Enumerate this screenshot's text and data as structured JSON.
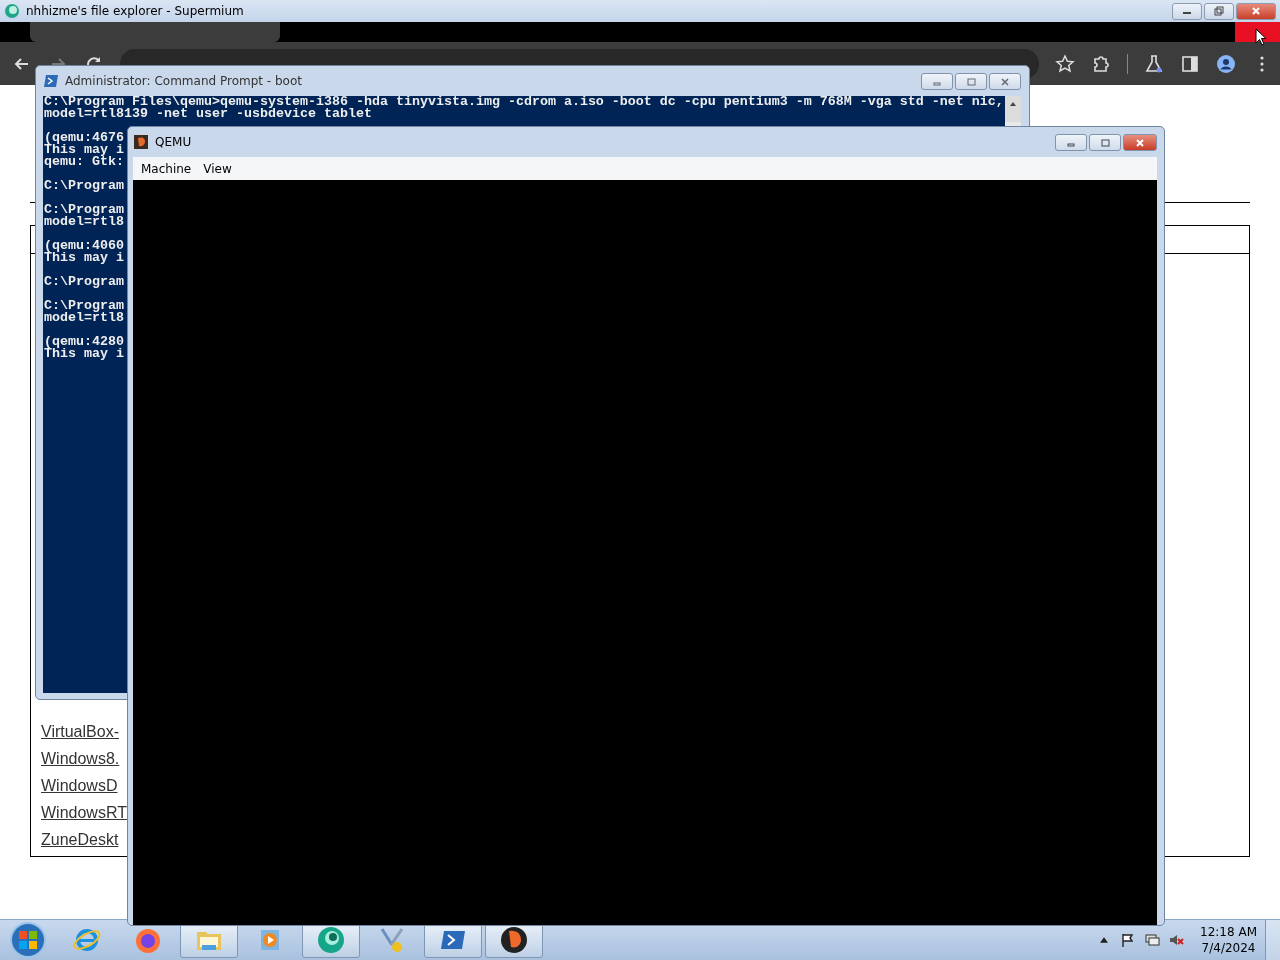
{
  "browser": {
    "title": "nhhizme's file explorer - Supermium",
    "links": [
      "VirtualBox-",
      "Windows8.",
      "WindowsD",
      "WindowsRT",
      "ZuneDeskt"
    ]
  },
  "cmd_window": {
    "title": "Administrator: Command Prompt - boot",
    "blocks": [
      [
        "C:\\Program Files\\qemu>qemu-system-i386 -hda tinyvista.img -cdrom a.iso -boot dc -cpu pentium3 -m 768M -vga std -net nic,",
        "model=rtl8139 -net user -usbdevice tablet"
      ],
      [
        "(qemu:4676",
        "This may i",
        "qemu: Gtk:"
      ],
      [
        "C:\\Program"
      ],
      [
        "C:\\Program",
        "model=rtl8"
      ],
      [
        "(qemu:4060",
        "This may i"
      ],
      [
        "C:\\Program"
      ],
      [
        "C:\\Program",
        "model=rtl8"
      ],
      [
        "(qemu:4280",
        "This may i"
      ]
    ]
  },
  "qemu_window": {
    "title": "QEMU",
    "menu": [
      "Machine",
      "View"
    ]
  },
  "taskbar": {
    "buttons": [
      {
        "kind": "ie",
        "running": false
      },
      {
        "kind": "firefox",
        "running": false
      },
      {
        "kind": "folder",
        "running": true
      },
      {
        "kind": "media",
        "running": false
      },
      {
        "kind": "supermium",
        "running": true
      },
      {
        "kind": "tools",
        "running": false
      },
      {
        "kind": "terminal",
        "running": true
      },
      {
        "kind": "qemu",
        "running": true
      }
    ],
    "time": "12:18 AM",
    "date": "7/4/2024"
  }
}
